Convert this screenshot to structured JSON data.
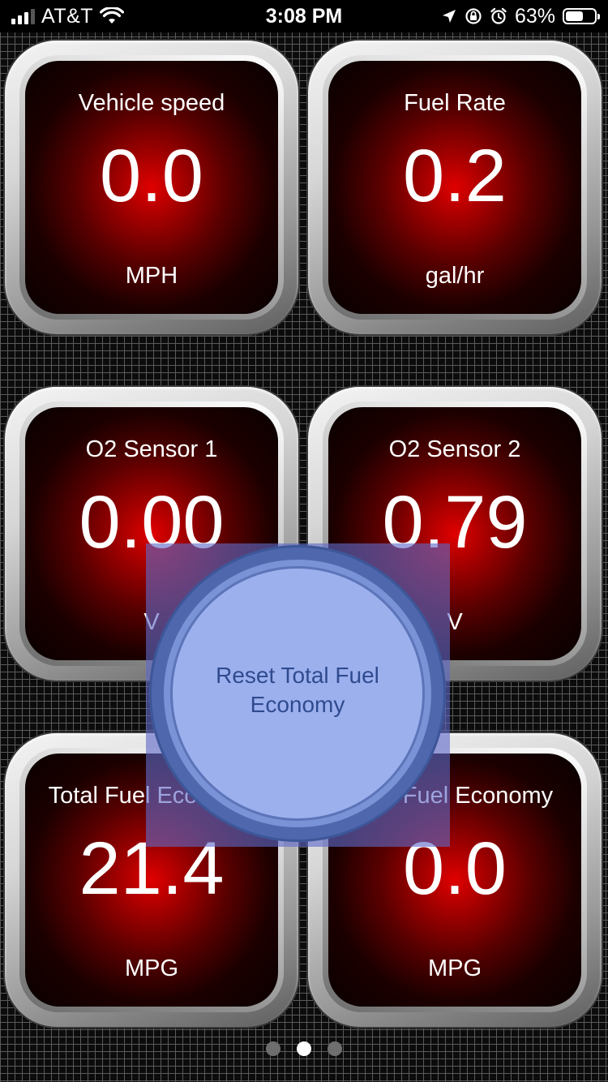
{
  "status_bar": {
    "carrier": "AT&T",
    "time": "3:08 PM",
    "battery_percent": "63%",
    "battery_level": 0.63,
    "icons": [
      "signal-icon",
      "wifi-icon",
      "location-icon",
      "orientation-lock-icon",
      "alarm-icon",
      "battery-icon"
    ]
  },
  "gauges": [
    {
      "label": "Vehicle speed",
      "value": "0.0",
      "unit": "MPH"
    },
    {
      "label": "Fuel Rate",
      "value": "0.2",
      "unit": "gal/hr"
    },
    {
      "label": "O2 Sensor 1",
      "value": "0.00",
      "unit": "V"
    },
    {
      "label": "O2 Sensor 2",
      "value": "0.79",
      "unit": "V"
    },
    {
      "label": "Total Fuel Economy",
      "value": "21.4",
      "unit": "MPG"
    },
    {
      "label": "Trip Fuel Economy",
      "value": "0.0",
      "unit": "MPG"
    }
  ],
  "reset_button": {
    "label": "Reset Total Fuel Economy"
  },
  "pager": {
    "page_count": 3,
    "current_page": 2
  },
  "colors": {
    "gauge_face": "#e00000",
    "overlay": "#5f69c8",
    "button": "#9db0ee",
    "button_text": "#2f4b8f"
  }
}
